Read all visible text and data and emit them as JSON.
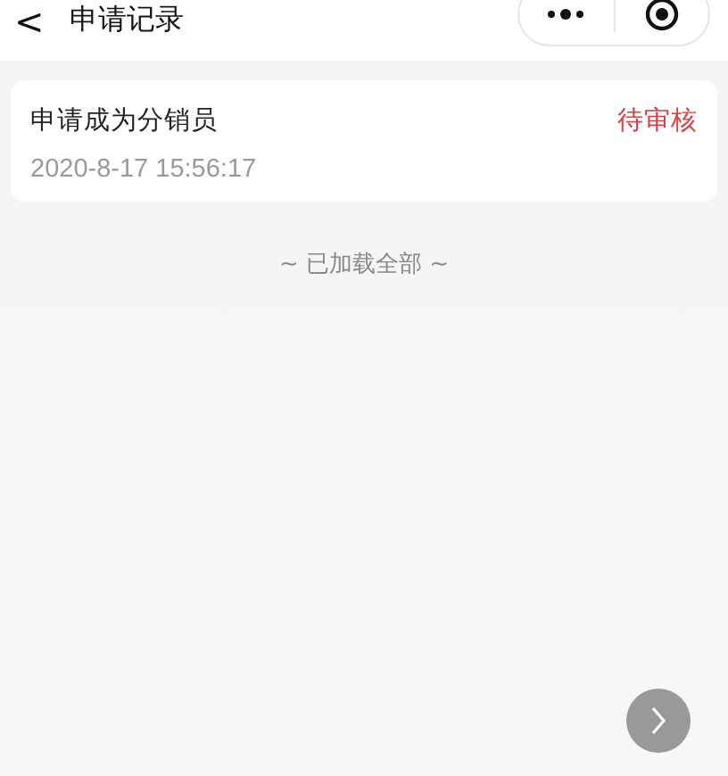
{
  "header": {
    "back": "<",
    "title": "申请记录"
  },
  "records": [
    {
      "title": "申请成为分销员",
      "status": "待审核",
      "time": "2020-8-17 15:56:17"
    }
  ],
  "footer_note": "~ 已加载全部 ~"
}
